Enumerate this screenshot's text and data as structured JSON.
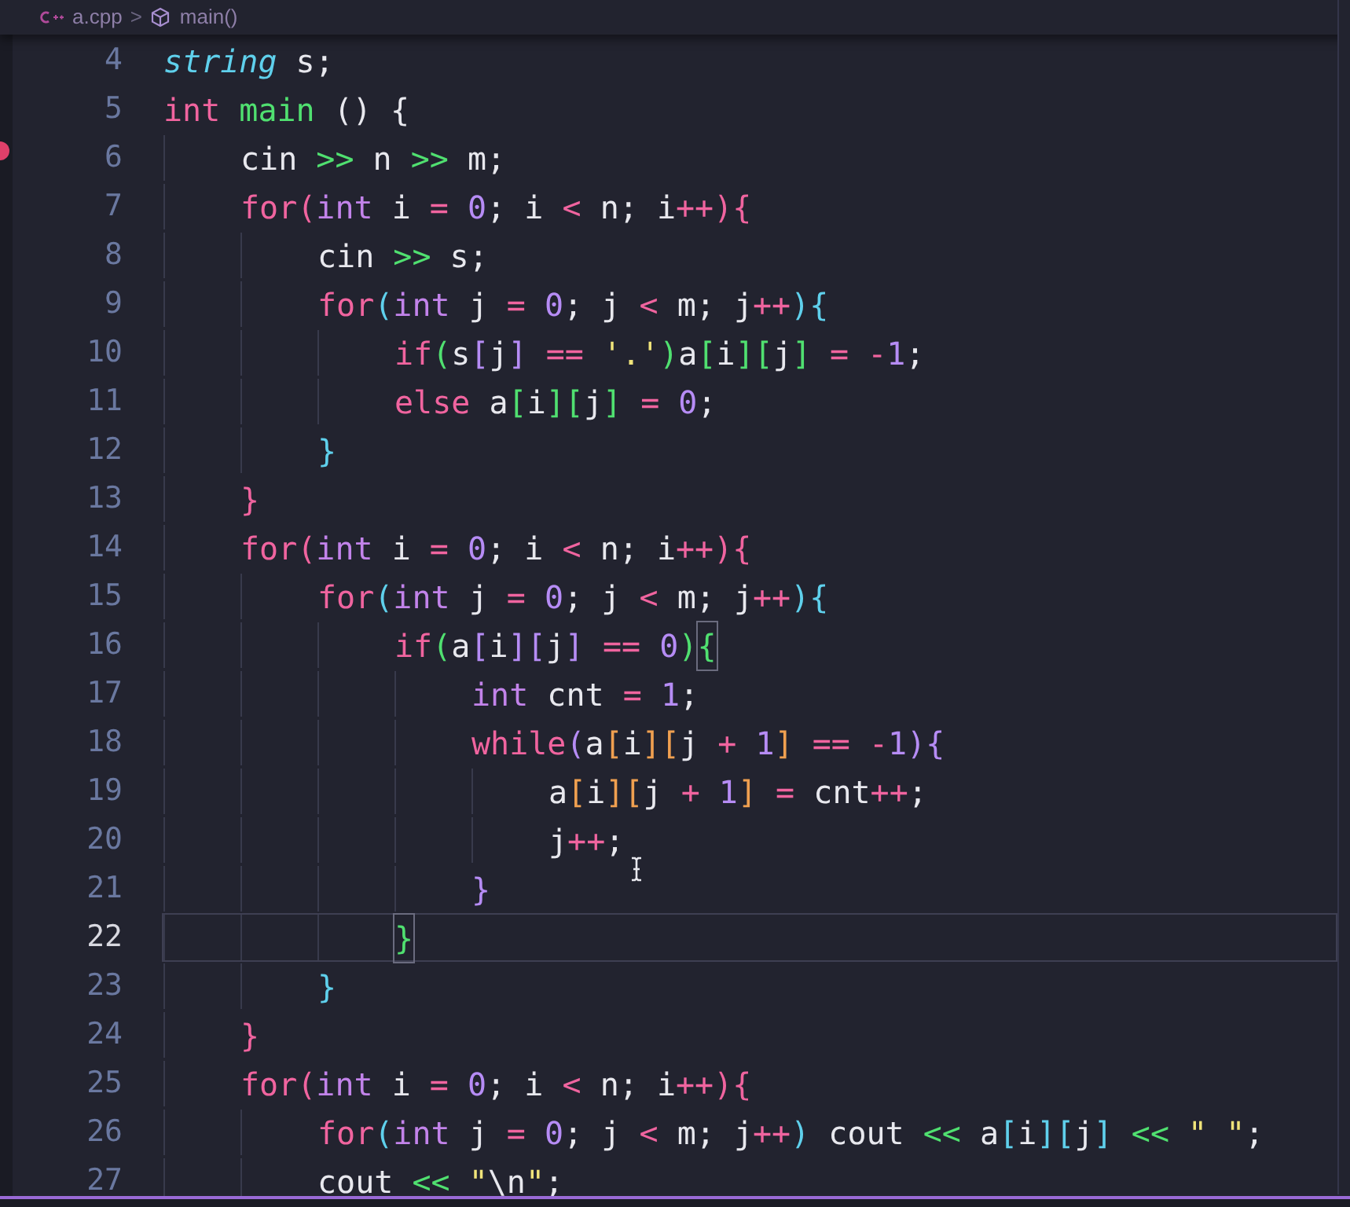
{
  "breadcrumb": {
    "file": "a.cpp",
    "separator": ">",
    "symbol": "main()"
  },
  "lines": [
    {
      "number": "4",
      "current": false,
      "tokens": [
        {
          "text": "string",
          "kind": "type-italic"
        },
        {
          "text": " s;",
          "kind": "plain"
        }
      ]
    },
    {
      "number": "5",
      "current": false,
      "tokens": [
        {
          "text": "int",
          "kind": "keyword"
        },
        {
          "text": " main",
          "kind": "function"
        },
        {
          "text": " () {",
          "kind": "plain"
        }
      ],
      "children": [
        {
          "number": "6",
          "current": false,
          "tokens": [
            {
              "text": "cin ",
              "kind": "plain"
            },
            {
              "text": ">>",
              "kind": "stream"
            },
            {
              "text": " n ",
              "kind": "plain"
            },
            {
              "text": ">>",
              "kind": "stream"
            },
            {
              "text": " m;",
              "kind": "plain"
            }
          ]
        },
        {
          "number": "7",
          "current": false,
          "tokens": [
            {
              "text": "for",
              "kind": "keyword"
            },
            {
              "text": "(",
              "kind": "bracket-pink"
            },
            {
              "text": "int",
              "kind": "type"
            },
            {
              "text": " i ",
              "kind": "plain"
            },
            {
              "text": "= ",
              "kind": "operator"
            },
            {
              "text": "0",
              "kind": "number"
            },
            {
              "text": "; i ",
              "kind": "plain"
            },
            {
              "text": "<",
              "kind": "operator"
            },
            {
              "text": " n; i",
              "kind": "plain"
            },
            {
              "text": "++",
              "kind": "operator"
            },
            {
              "text": ")",
              "kind": "bracket-pink"
            },
            {
              "text": "{",
              "kind": "bracket-pink"
            }
          ],
          "children": [
            {
              "number": "8",
              "current": false,
              "tokens": [
                {
                  "text": "cin ",
                  "kind": "plain"
                },
                {
                  "text": ">>",
                  "kind": "stream"
                },
                {
                  "text": " s;",
                  "kind": "plain"
                }
              ]
            },
            {
              "number": "9",
              "current": false,
              "tokens": [
                {
                  "text": "for",
                  "kind": "keyword"
                },
                {
                  "text": "(",
                  "kind": "bracket-cyan"
                },
                {
                  "text": "int",
                  "kind": "type"
                },
                {
                  "text": " j ",
                  "kind": "plain"
                },
                {
                  "text": "= ",
                  "kind": "operator"
                },
                {
                  "text": "0",
                  "kind": "number"
                },
                {
                  "text": "; j ",
                  "kind": "plain"
                },
                {
                  "text": "<",
                  "kind": "operator"
                },
                {
                  "text": " m; j",
                  "kind": "plain"
                },
                {
                  "text": "++",
                  "kind": "operator"
                },
                {
                  "text": ")",
                  "kind": "bracket-cyan"
                },
                {
                  "text": "{",
                  "kind": "bracket-cyan"
                }
              ],
              "children": [
                {
                  "number": "10",
                  "current": false,
                  "tokens": [
                    {
                      "text": "if",
                      "kind": "keyword"
                    },
                    {
                      "text": "(",
                      "kind": "bracket-green"
                    },
                    {
                      "text": "s",
                      "kind": "plain"
                    },
                    {
                      "text": "[",
                      "kind": "bracket-purple"
                    },
                    {
                      "text": "j",
                      "kind": "plain"
                    },
                    {
                      "text": "]",
                      "kind": "bracket-purple"
                    },
                    {
                      "text": " == ",
                      "kind": "operator"
                    },
                    {
                      "text": "'.'",
                      "kind": "string"
                    },
                    {
                      "text": ")",
                      "kind": "bracket-green"
                    },
                    {
                      "text": "a",
                      "kind": "plain"
                    },
                    {
                      "text": "[",
                      "kind": "bracket-green"
                    },
                    {
                      "text": "i",
                      "kind": "plain"
                    },
                    {
                      "text": "]",
                      "kind": "bracket-green"
                    },
                    {
                      "text": "[",
                      "kind": "bracket-green"
                    },
                    {
                      "text": "j",
                      "kind": "plain"
                    },
                    {
                      "text": "]",
                      "kind": "bracket-green"
                    },
                    {
                      "text": " = -",
                      "kind": "operator"
                    },
                    {
                      "text": "1",
                      "kind": "number"
                    },
                    {
                      "text": ";",
                      "kind": "plain"
                    }
                  ]
                },
                {
                  "number": "11",
                  "current": false,
                  "tokens": [
                    {
                      "text": "else",
                      "kind": "keyword"
                    },
                    {
                      "text": " a",
                      "kind": "plain"
                    },
                    {
                      "text": "[",
                      "kind": "bracket-green"
                    },
                    {
                      "text": "i",
                      "kind": "plain"
                    },
                    {
                      "text": "]",
                      "kind": "bracket-green"
                    },
                    {
                      "text": "[",
                      "kind": "bracket-green"
                    },
                    {
                      "text": "j",
                      "kind": "plain"
                    },
                    {
                      "text": "]",
                      "kind": "bracket-green"
                    },
                    {
                      "text": " = ",
                      "kind": "operator"
                    },
                    {
                      "text": "0",
                      "kind": "number"
                    },
                    {
                      "text": ";",
                      "kind": "plain"
                    }
                  ]
                }
              ]
            },
            {
              "number": "12",
              "current": false,
              "tokens": [
                {
                  "text": "}",
                  "kind": "bracket-cyan"
                }
              ]
            }
          ]
        },
        {
          "number": "13",
          "current": false,
          "tokens": [
            {
              "text": "}",
              "kind": "bracket-pink"
            }
          ]
        },
        {
          "number": "14",
          "current": false,
          "tokens": [
            {
              "text": "for",
              "kind": "keyword"
            },
            {
              "text": "(",
              "kind": "bracket-pink"
            },
            {
              "text": "int",
              "kind": "type"
            },
            {
              "text": " i ",
              "kind": "plain"
            },
            {
              "text": "= ",
              "kind": "operator"
            },
            {
              "text": "0",
              "kind": "number"
            },
            {
              "text": "; i ",
              "kind": "plain"
            },
            {
              "text": "<",
              "kind": "operator"
            },
            {
              "text": " n; i",
              "kind": "plain"
            },
            {
              "text": "++",
              "kind": "operator"
            },
            {
              "text": ")",
              "kind": "bracket-pink"
            },
            {
              "text": "{",
              "kind": "bracket-pink"
            }
          ],
          "children": [
            {
              "number": "15",
              "current": false,
              "tokens": [
                {
                  "text": "for",
                  "kind": "keyword"
                },
                {
                  "text": "(",
                  "kind": "bracket-cyan"
                },
                {
                  "text": "int",
                  "kind": "type"
                },
                {
                  "text": " j ",
                  "kind": "plain"
                },
                {
                  "text": "= ",
                  "kind": "operator"
                },
                {
                  "text": "0",
                  "kind": "number"
                },
                {
                  "text": "; j ",
                  "kind": "plain"
                },
                {
                  "text": "<",
                  "kind": "operator"
                },
                {
                  "text": " m; j",
                  "kind": "plain"
                },
                {
                  "text": "++",
                  "kind": "operator"
                },
                {
                  "text": ")",
                  "kind": "bracket-cyan"
                },
                {
                  "text": "{",
                  "kind": "bracket-cyan"
                }
              ],
              "children": [
                {
                  "number": "16",
                  "current": false,
                  "tokens": [
                    {
                      "text": "if",
                      "kind": "keyword"
                    },
                    {
                      "text": "(",
                      "kind": "bracket-green"
                    },
                    {
                      "text": "a",
                      "kind": "plain"
                    },
                    {
                      "text": "[",
                      "kind": "bracket-purple"
                    },
                    {
                      "text": "i",
                      "kind": "plain"
                    },
                    {
                      "text": "]",
                      "kind": "bracket-purple"
                    },
                    {
                      "text": "[",
                      "kind": "bracket-purple"
                    },
                    {
                      "text": "j",
                      "kind": "plain"
                    },
                    {
                      "text": "]",
                      "kind": "bracket-purple"
                    },
                    {
                      "text": " == ",
                      "kind": "operator"
                    },
                    {
                      "text": "0",
                      "kind": "number"
                    },
                    {
                      "text": ")",
                      "kind": "bracket-green"
                    },
                    {
                      "text": "{",
                      "kind": "bracket-green",
                      "matched": true
                    }
                  ],
                  "children": [
                    {
                      "number": "17",
                      "current": false,
                      "tokens": [
                        {
                          "text": "int",
                          "kind": "type"
                        },
                        {
                          "text": " cnt ",
                          "kind": "plain"
                        },
                        {
                          "text": "= ",
                          "kind": "operator"
                        },
                        {
                          "text": "1",
                          "kind": "number"
                        },
                        {
                          "text": ";",
                          "kind": "plain"
                        }
                      ]
                    },
                    {
                      "number": "18",
                      "current": false,
                      "tokens": [
                        {
                          "text": "while",
                          "kind": "keyword"
                        },
                        {
                          "text": "(",
                          "kind": "bracket-purple"
                        },
                        {
                          "text": "a",
                          "kind": "plain"
                        },
                        {
                          "text": "[",
                          "kind": "bracket-orange"
                        },
                        {
                          "text": "i",
                          "kind": "plain"
                        },
                        {
                          "text": "]",
                          "kind": "bracket-orange"
                        },
                        {
                          "text": "[",
                          "kind": "bracket-orange"
                        },
                        {
                          "text": "j ",
                          "kind": "plain"
                        },
                        {
                          "text": "+ ",
                          "kind": "operator"
                        },
                        {
                          "text": "1",
                          "kind": "number"
                        },
                        {
                          "text": "]",
                          "kind": "bracket-orange"
                        },
                        {
                          "text": " == -",
                          "kind": "operator"
                        },
                        {
                          "text": "1",
                          "kind": "number"
                        },
                        {
                          "text": ")",
                          "kind": "bracket-purple"
                        },
                        {
                          "text": "{",
                          "kind": "bracket-purple"
                        }
                      ],
                      "children": [
                        {
                          "number": "19",
                          "current": false,
                          "tokens": [
                            {
                              "text": "a",
                              "kind": "plain"
                            },
                            {
                              "text": "[",
                              "kind": "bracket-orange"
                            },
                            {
                              "text": "i",
                              "kind": "plain"
                            },
                            {
                              "text": "]",
                              "kind": "bracket-orange"
                            },
                            {
                              "text": "[",
                              "kind": "bracket-orange"
                            },
                            {
                              "text": "j ",
                              "kind": "plain"
                            },
                            {
                              "text": "+ ",
                              "kind": "operator"
                            },
                            {
                              "text": "1",
                              "kind": "number"
                            },
                            {
                              "text": "]",
                              "kind": "bracket-orange"
                            },
                            {
                              "text": " =",
                              "kind": "operator"
                            },
                            {
                              "text": " cnt",
                              "kind": "plain"
                            },
                            {
                              "text": "++",
                              "kind": "operator"
                            },
                            {
                              "text": ";",
                              "kind": "plain"
                            }
                          ]
                        },
                        {
                          "number": "20",
                          "current": false,
                          "tokens": [
                            {
                              "text": "j",
                              "kind": "plain"
                            },
                            {
                              "text": "++",
                              "kind": "operator"
                            },
                            {
                              "text": ";",
                              "kind": "plain"
                            }
                          ]
                        }
                      ]
                    },
                    {
                      "number": "21",
                      "current": false,
                      "tokens": [
                        {
                          "text": "}",
                          "kind": "bracket-purple"
                        }
                      ]
                    }
                  ]
                },
                {
                  "number": "22",
                  "current": true,
                  "tokens": [
                    {
                      "text": "}",
                      "kind": "bracket-green",
                      "matched": true
                    }
                  ]
                }
              ]
            },
            {
              "number": "23",
              "current": false,
              "tokens": [
                {
                  "text": "}",
                  "kind": "bracket-cyan"
                }
              ]
            }
          ]
        },
        {
          "number": "24",
          "current": false,
          "tokens": [
            {
              "text": "}",
              "kind": "bracket-pink"
            }
          ]
        },
        {
          "number": "25",
          "current": false,
          "tokens": [
            {
              "text": "for",
              "kind": "keyword"
            },
            {
              "text": "(",
              "kind": "bracket-pink"
            },
            {
              "text": "int",
              "kind": "type"
            },
            {
              "text": " i ",
              "kind": "plain"
            },
            {
              "text": "= ",
              "kind": "operator"
            },
            {
              "text": "0",
              "kind": "number"
            },
            {
              "text": "; i ",
              "kind": "plain"
            },
            {
              "text": "<",
              "kind": "operator"
            },
            {
              "text": " n; i",
              "kind": "plain"
            },
            {
              "text": "++",
              "kind": "operator"
            },
            {
              "text": ")",
              "kind": "bracket-pink"
            },
            {
              "text": "{",
              "kind": "bracket-pink"
            }
          ],
          "children": [
            {
              "number": "26",
              "current": false,
              "tokens": [
                {
                  "text": "for",
                  "kind": "keyword"
                },
                {
                  "text": "(",
                  "kind": "bracket-cyan"
                },
                {
                  "text": "int",
                  "kind": "type"
                },
                {
                  "text": " j ",
                  "kind": "plain"
                },
                {
                  "text": "= ",
                  "kind": "operator"
                },
                {
                  "text": "0",
                  "kind": "number"
                },
                {
                  "text": "; j ",
                  "kind": "plain"
                },
                {
                  "text": "<",
                  "kind": "operator"
                },
                {
                  "text": " m; j",
                  "kind": "plain"
                },
                {
                  "text": "++",
                  "kind": "operator"
                },
                {
                  "text": ")",
                  "kind": "bracket-cyan"
                },
                {
                  "text": " cout ",
                  "kind": "plain"
                },
                {
                  "text": "<<",
                  "kind": "stream"
                },
                {
                  "text": " a",
                  "kind": "plain"
                },
                {
                  "text": "[",
                  "kind": "bracket-cyan"
                },
                {
                  "text": "i",
                  "kind": "plain"
                },
                {
                  "text": "]",
                  "kind": "bracket-cyan"
                },
                {
                  "text": "[",
                  "kind": "bracket-cyan"
                },
                {
                  "text": "j",
                  "kind": "plain"
                },
                {
                  "text": "]",
                  "kind": "bracket-cyan"
                },
                {
                  "text": " <<",
                  "kind": "stream"
                },
                {
                  "text": " \" \"",
                  "kind": "string"
                },
                {
                  "text": ";",
                  "kind": "plain"
                }
              ]
            },
            {
              "number": "27",
              "current": false,
              "tokens": [
                {
                  "text": "cout ",
                  "kind": "plain"
                },
                {
                  "text": "<< ",
                  "kind": "stream"
                },
                {
                  "text": "\"",
                  "kind": "string"
                },
                {
                  "text": "\\n",
                  "kind": "plain"
                },
                {
                  "text": "\"",
                  "kind": "string"
                },
                {
                  "text": ";",
                  "kind": "plain"
                }
              ]
            }
          ]
        }
      ]
    }
  ]
}
